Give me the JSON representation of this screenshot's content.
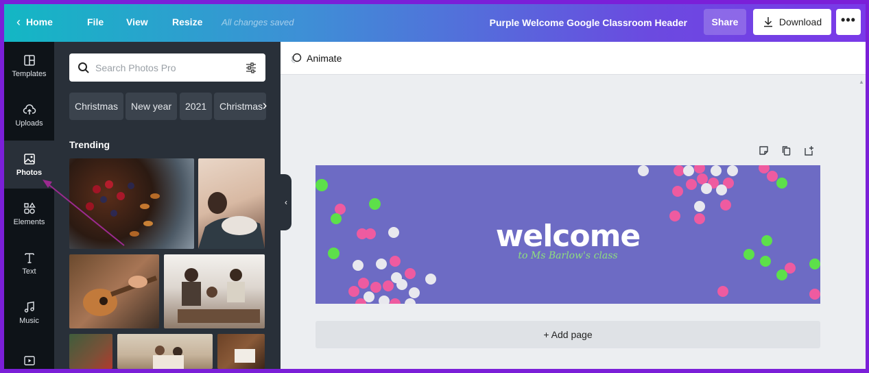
{
  "topbar": {
    "home": "Home",
    "file": "File",
    "view": "View",
    "resize": "Resize",
    "saved_status": "All changes saved",
    "doc_title": "Purple Welcome Google Classroom Header",
    "share": "Share",
    "download": "Download",
    "more": "•••"
  },
  "rail": {
    "items": [
      {
        "label": "Templates",
        "icon": "templates-icon"
      },
      {
        "label": "Uploads",
        "icon": "upload-cloud-icon"
      },
      {
        "label": "Photos",
        "icon": "photo-icon",
        "active": true
      },
      {
        "label": "Elements",
        "icon": "shapes-icon"
      },
      {
        "label": "Text",
        "icon": "text-icon"
      },
      {
        "label": "Music",
        "icon": "music-note-icon"
      },
      {
        "label": "",
        "icon": "video-icon"
      }
    ]
  },
  "panel": {
    "search_placeholder": "Search Photos Pro",
    "chips": [
      "Christmas",
      "New year",
      "2021",
      "Christmas"
    ],
    "section_title": "Trending"
  },
  "editor": {
    "animate": "Animate",
    "add_page": "+ Add page"
  },
  "design": {
    "title": "welcome",
    "subtitle": "to Ms Barlow's class",
    "background_color": "#6d6bc4"
  },
  "colors": {
    "accent": "#7b1fd8",
    "confetti_pink": "#ee5ba0",
    "confetti_green": "#5de04a",
    "confetti_white": "#e8e8ee"
  }
}
